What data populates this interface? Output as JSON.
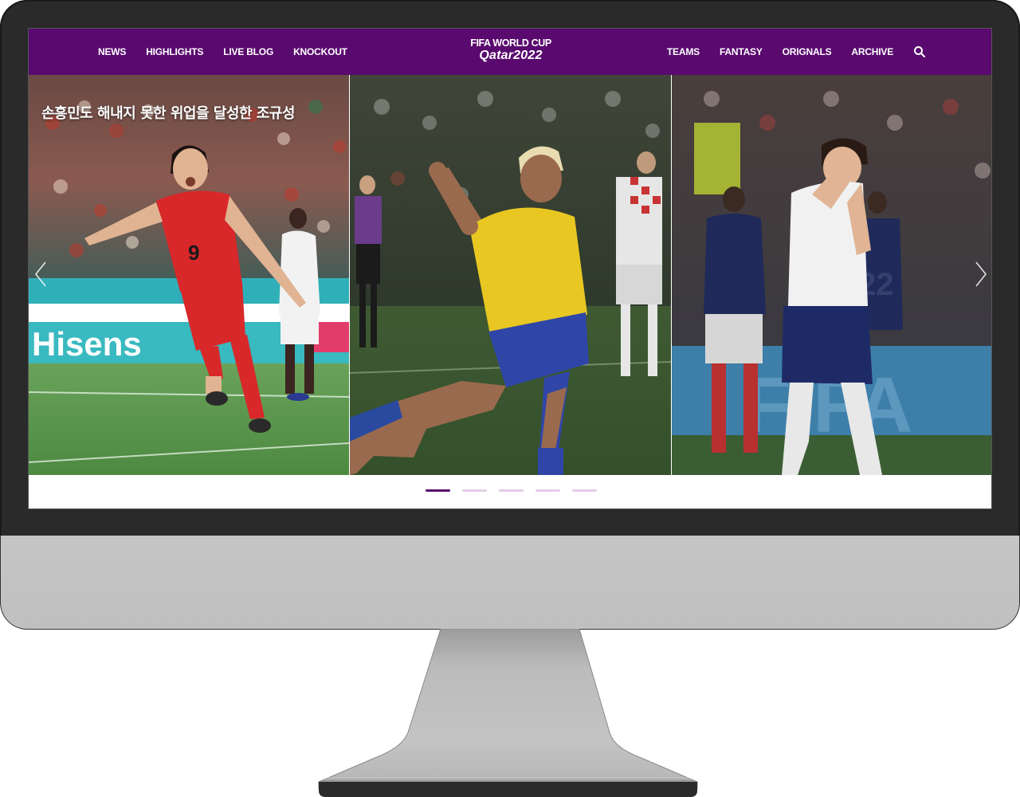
{
  "nav": {
    "left_items": [
      "NEWS",
      "HIGHLIGHTS",
      "LIVE BLOG",
      "KNOCKOUT"
    ],
    "right_items": [
      "TEAMS",
      "FANTASY",
      "ORIGNALS",
      "ARCHIVE"
    ],
    "logo_line1": "FIFA WORLD CUP",
    "logo_line2": "Qatar2022",
    "search_icon": "search-icon",
    "bar_color": "#5a0a6f"
  },
  "carousel": {
    "slides": [
      {
        "caption": "손흥민도 해내지 못한 위업을 달성한 조규성",
        "image": "korea-player-celebrating-photo"
      },
      {
        "caption": "",
        "image": "brazil-player-celebrating-photo"
      },
      {
        "caption": "",
        "image": "england-player-dejected-photo"
      }
    ],
    "prev_icon": "chevron-left-icon",
    "next_icon": "chevron-right-icon"
  },
  "pagination": {
    "total": 5,
    "active_index": 0,
    "active_color": "#5a0a6f",
    "inactive_color": "#e3cde8"
  }
}
